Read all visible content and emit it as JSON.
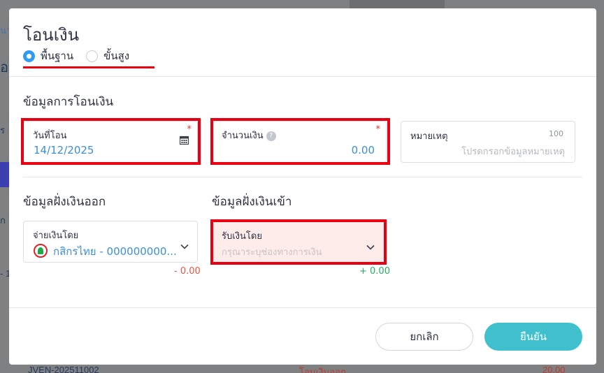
{
  "background": {
    "fragments": [
      "นา",
      "อ",
      "บ้า",
      "ร",
      "ก",
      "บ",
      "- 1",
      "อ",
      "JVEN-202511002",
      "โอนเงินออก",
      "20.00",
      "u"
    ]
  },
  "modal": {
    "title": "โอนเงิน",
    "modes": [
      {
        "label": "พื้นฐาน",
        "selected": true
      },
      {
        "label": "ขั้นสูง",
        "selected": false
      }
    ]
  },
  "transfer_info": {
    "title": "ข้อมูลการโอนเงิน",
    "date": {
      "label": "วันที่โอน",
      "value": "14/12/2025",
      "required_mark": "*",
      "icon": "calendar-icon"
    },
    "amount": {
      "label": "จำนวนเงิน",
      "value": "0.00",
      "required_mark": "*",
      "help_icon": "?"
    },
    "note": {
      "label": "หมายเหตุ",
      "counter": "100",
      "placeholder": "โปรดกรอกข้อมูลหมายเหตุ"
    }
  },
  "outgoing": {
    "title": "ข้อมูลฝั่งเงินออก",
    "label": "จ่ายเงินโดย",
    "value": "กสิกรไทย - 000000000...",
    "bank_icon": "kasikorn-bank-logo-icon",
    "amount": "- 0.00"
  },
  "incoming": {
    "title": "ข้อมูลฝั่งเงินเข้า",
    "label": "รับเงินโดย",
    "placeholder": "กรุณาระบุช่องทางการเงิน",
    "amount": "+ 0.00"
  },
  "footer": {
    "cancel_label": "ยกเลิก",
    "confirm_label": "ยืนยัน"
  },
  "colors": {
    "accent": "#3fc0cc",
    "radio_active": "#2f9cf2",
    "value_text": "#3d8fd1",
    "required": "#e2372b",
    "annotation_red": "#e60012",
    "error_bg": "#fdecea",
    "negative": "#e05545",
    "positive": "#27ae60"
  }
}
